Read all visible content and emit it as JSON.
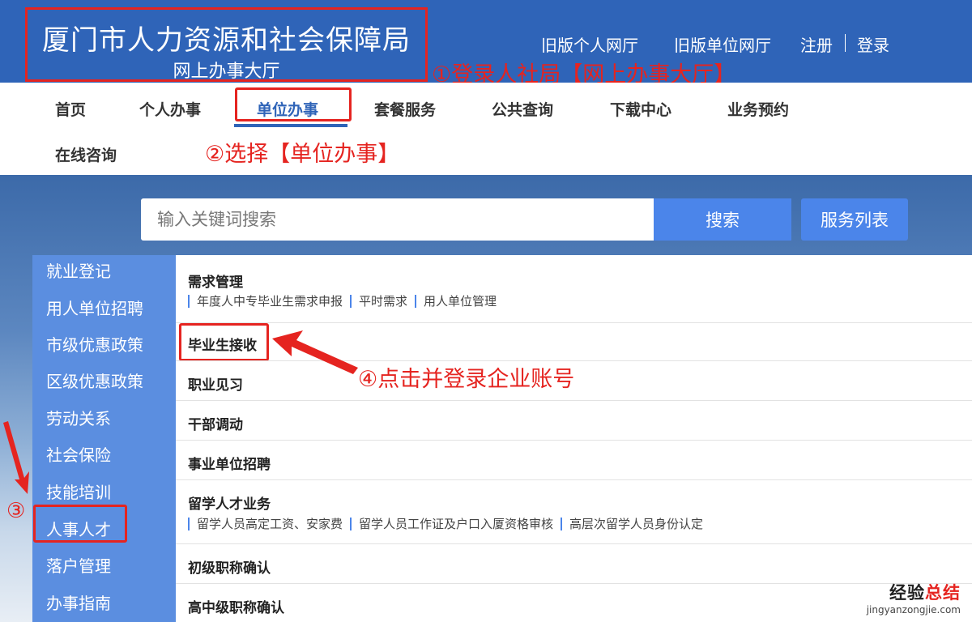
{
  "header": {
    "title": "厦门市人力资源和社会保障局",
    "subtitle": "网上办事大厅",
    "links": {
      "old_personal": "旧版个人网厅",
      "old_unit": "旧版单位网厅",
      "register": "注册",
      "login": "登录"
    }
  },
  "annotations": {
    "step1": "①登录人社局【网上办事大厅】",
    "step2": "②选择【单位办事】",
    "step3": "③",
    "step4": "④点击并登录企业账号"
  },
  "nav": {
    "home": "首页",
    "personal": "个人办事",
    "unit": "单位办事",
    "package": "套餐服务",
    "public_query": "公共查询",
    "download": "下载中心",
    "appointment": "业务预约",
    "consult": "在线咨询"
  },
  "search": {
    "placeholder": "输入关键词搜索",
    "button": "搜索",
    "service_list": "服务列表"
  },
  "sidebar": {
    "items": [
      "就业登记",
      "用人单位招聘",
      "市级优惠政策",
      "区级优惠政策",
      "劳动关系",
      "社会保险",
      "技能培训",
      "人事人才",
      "落户管理",
      "办事指南"
    ]
  },
  "content": {
    "demand": {
      "title": "需求管理",
      "links": [
        "年度人中专毕业生需求申报",
        "平时需求",
        "用人单位管理"
      ]
    },
    "graduate": "毕业生接收",
    "internship": "职业见习",
    "cadre": "干部调动",
    "public_recruit": "事业单位招聘",
    "overseas": {
      "title": "留学人才业务",
      "links": [
        "留学人员高定工资、安家费",
        "留学人员工作证及户口入厦资格审核",
        "高层次留学人员身份认定"
      ]
    },
    "junior_title": "初级职称确认",
    "senior_title": "高中级职称确认"
  },
  "watermark": {
    "main_a": "经验",
    "main_b": "总结",
    "sub": "jingyanzongjie.com"
  },
  "colors": {
    "header_bg": "#2f64b8",
    "accent_blue": "#4b85ea",
    "sidebar_bg": "#5b8ee0",
    "annotation_red": "#e52420"
  }
}
